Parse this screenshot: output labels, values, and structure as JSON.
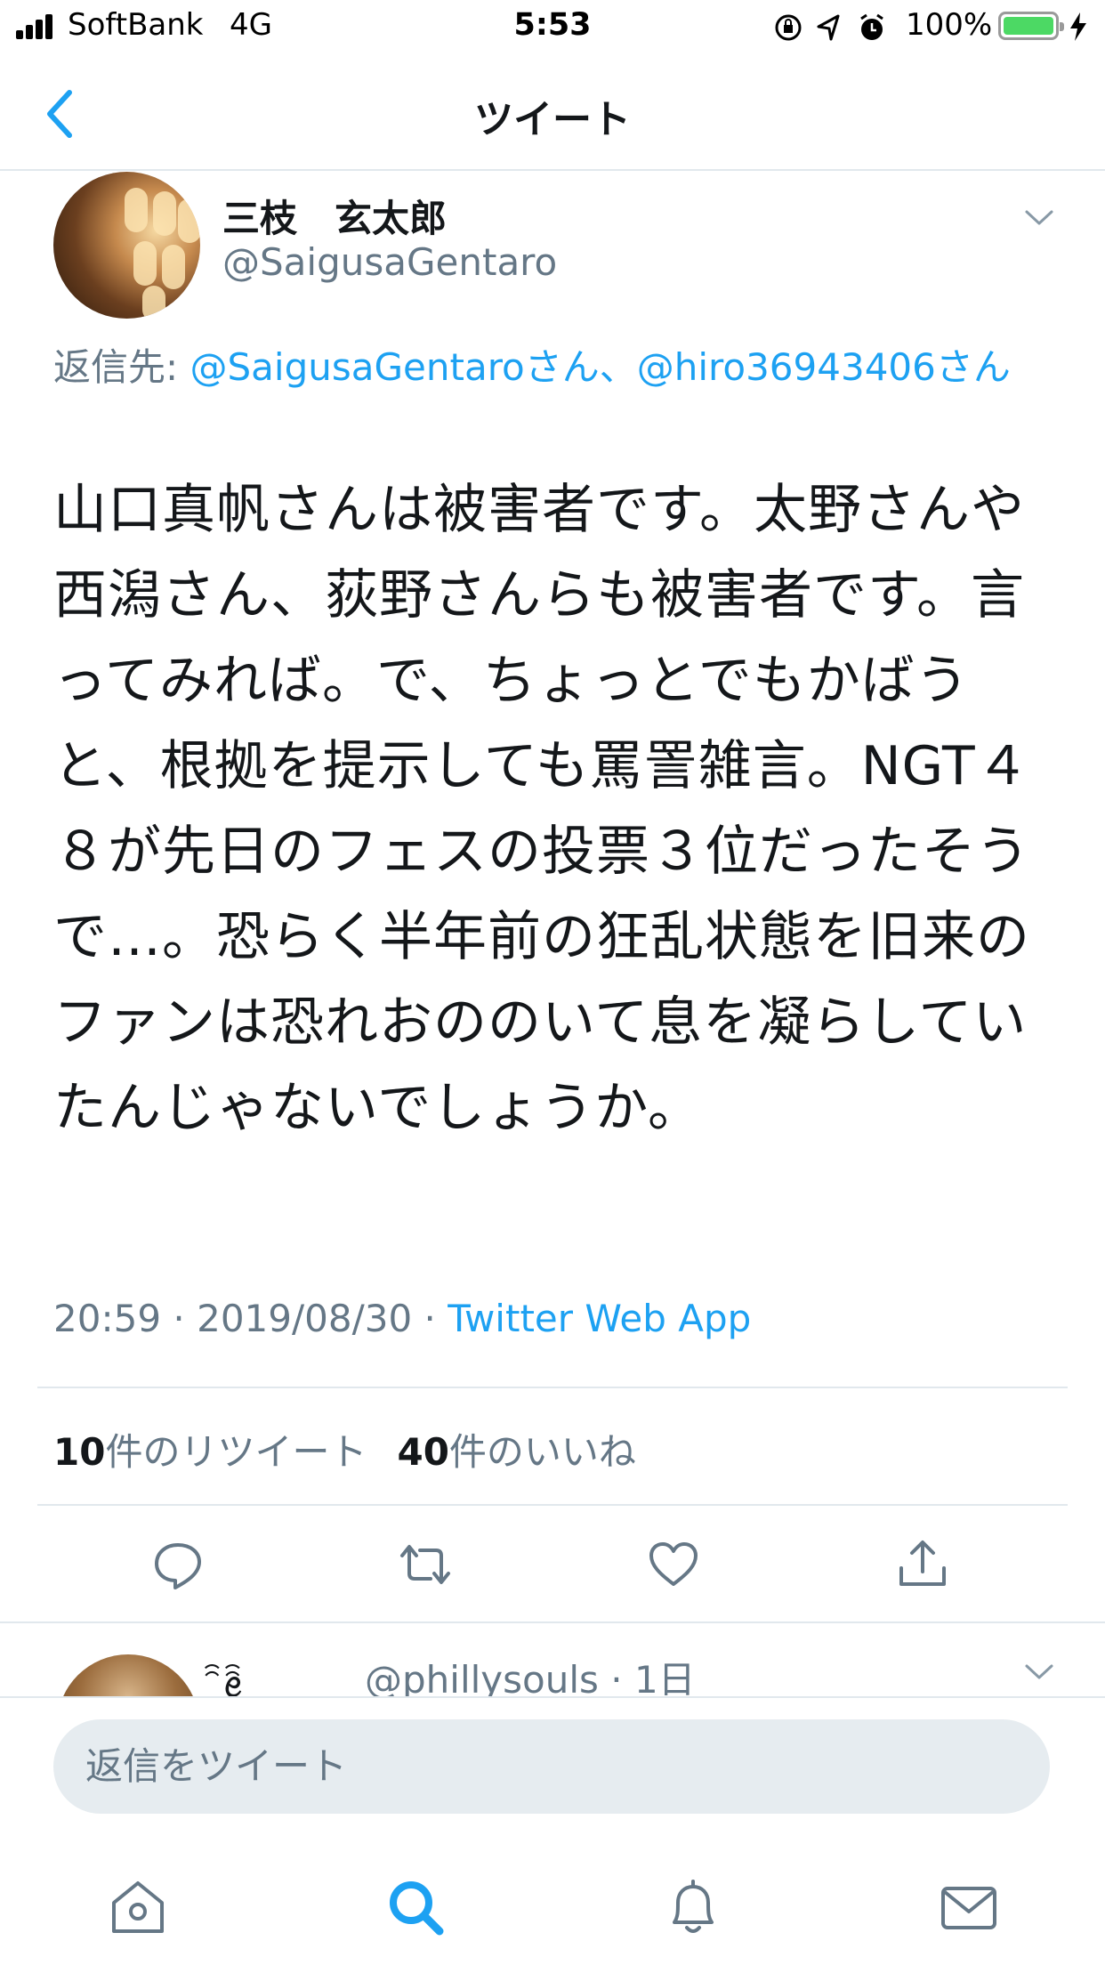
{
  "status_bar": {
    "carrier": "SoftBank",
    "network": "4G",
    "time": "5:53",
    "battery": "100%"
  },
  "nav": {
    "title": "ツイート"
  },
  "tweet": {
    "author_name": "三枝　玄太郎",
    "author_handle": "@SaigusaGentaro",
    "reply_to_label": "返信先: ",
    "reply_to_1": "@SaigusaGentaroさん",
    "reply_to_sep": "、",
    "reply_to_2": "@hiro36943406さん",
    "text": "山口真帆さんは被害者です。太野さんや西潟さん、荻野さんらも被害者です。言ってみれば。で、ちょっとでもかばうと、根拠を提示しても罵詈雑言。NGT４８が先日のフェスの投票３位だったそうで…。恐らく半年前の狂乱状態を旧来のファンは恐れおののいて息を凝らしていたんじゃないでしょうか。",
    "time": "20:59",
    "date": "2019/08/30",
    "separator": " · ",
    "source": "Twitter Web App",
    "retweet_count": "10",
    "retweet_label": "件のリツイート",
    "like_count": "40",
    "like_label": "件のいいね"
  },
  "next_reply": {
    "name": "ꩰꫀꩰ",
    "handle": "@phillysouls",
    "time": "· 1日"
  },
  "composer": {
    "placeholder": "返信をツイート"
  },
  "colors": {
    "accent": "#1da1f2",
    "muted": "#657786",
    "divider": "#e1e8ed"
  }
}
